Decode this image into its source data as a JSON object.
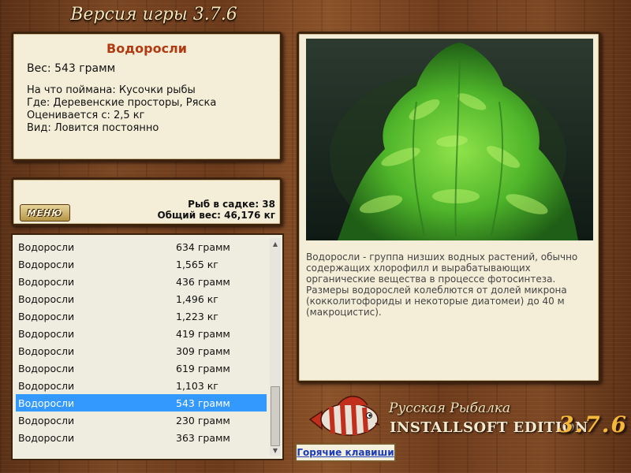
{
  "header": {
    "version_title": "Версия игры 3.7.6"
  },
  "fish_info": {
    "name": "Водоросли",
    "weight": "Вес: 543 грамм",
    "caught_on": "На что поймана: Кусочки рыбы",
    "location": "Где: Деревенские просторы, Ряска",
    "value_from": "Оценивается с: 2,5 кг",
    "kind": "Вид: Ловится постоянно"
  },
  "cage": {
    "menu_label": "МЕНЮ",
    "fish_count": "Рыб в садке: 38",
    "total_weight": "Общий вес: 46,176 кг"
  },
  "catch_list": {
    "selected_index": 9,
    "rows": [
      {
        "name": "Водоросли",
        "weight": "634 грамм"
      },
      {
        "name": "Водоросли",
        "weight": "1,565 кг"
      },
      {
        "name": "Водоросли",
        "weight": "436 грамм"
      },
      {
        "name": "Водоросли",
        "weight": "1,496 кг"
      },
      {
        "name": "Водоросли",
        "weight": "1,223 кг"
      },
      {
        "name": "Водоросли",
        "weight": "419 грамм"
      },
      {
        "name": "Водоросли",
        "weight": "309 грамм"
      },
      {
        "name": "Водоросли",
        "weight": "619 грамм"
      },
      {
        "name": "Водоросли",
        "weight": "1,103 кг"
      },
      {
        "name": "Водоросли",
        "weight": "543 грамм"
      },
      {
        "name": "Водоросли",
        "weight": "230 грамм"
      },
      {
        "name": "Водоросли",
        "weight": "363 грамм"
      }
    ]
  },
  "description": "Водоросли - группа низших водных растений, обычно содержащих хлорофилл и вырабатывающих органические вещества в процессе фотосинтеза. Размеры водорослей колеблются от долей микрона (кокколитофориды и некоторые диатомеи) до 40 м (макроцистис).",
  "logo": {
    "title": "Русская Рыбалка",
    "edition": "INSTALLSOFT EDITION",
    "version": "3.7.6"
  },
  "hotkeys_label": "Горячие клавиши",
  "icons": {
    "scroll_up": "arrow-up-icon",
    "scroll_down": "arrow-down-icon",
    "logo_fish": "fish-icon"
  },
  "colors": {
    "selection": "#3399ff",
    "fish_name": "#b23a10",
    "link": "#1a3ab8",
    "version_orange": "#f5b83a"
  }
}
